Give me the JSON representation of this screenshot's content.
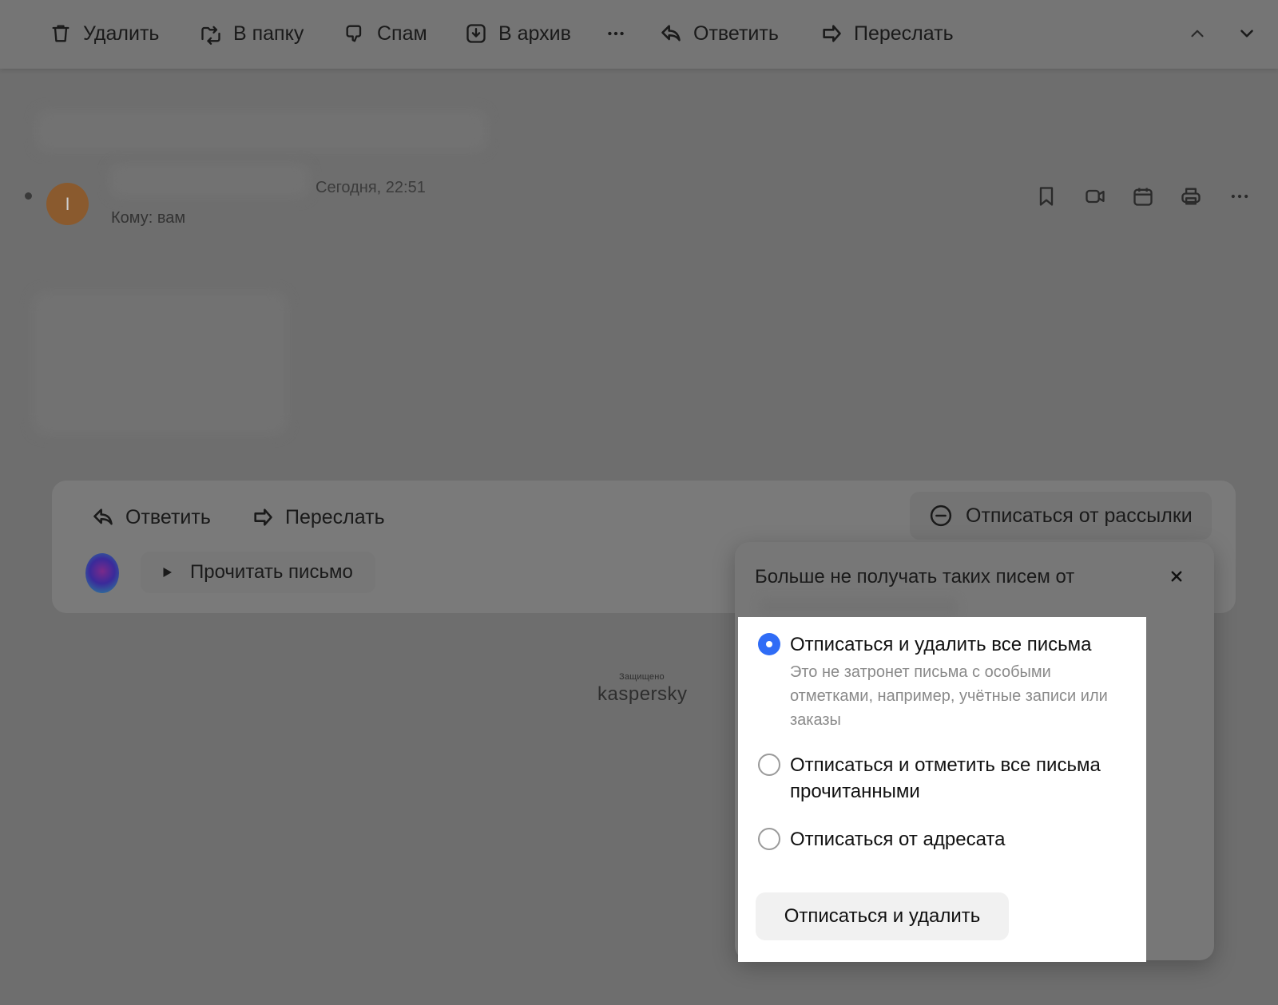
{
  "toolbar": {
    "delete": "Удалить",
    "move_to_folder": "В папку",
    "spam": "Спам",
    "archive": "В архив",
    "reply": "Ответить",
    "forward": "Переслать"
  },
  "message": {
    "date": "Сегодня, 22:51",
    "to": "Кому: вам",
    "avatar_letter": "I"
  },
  "reply_panel": {
    "reply": "Ответить",
    "forward": "Переслать",
    "unsubscribe": "Отписаться от рассылки",
    "read_aloud": "Прочитать письмо"
  },
  "kaspersky": {
    "protected": "Защищено",
    "logo": "kaspersky"
  },
  "popover": {
    "title": "Больше не получать таких писем от",
    "options": [
      {
        "label": "Отписаться и удалить все письма",
        "hint": "Это не затронет письма с особыми отметками, например, учётные записи или заказы",
        "selected": true
      },
      {
        "label": "Отписаться и отметить все письма прочитанными",
        "selected": false
      },
      {
        "label": "Отписаться от адресата",
        "selected": false
      }
    ],
    "submit": "Отписаться и удалить"
  },
  "colors": {
    "accent": "#2f6cf6",
    "avatar": "#8a5a2e",
    "overlay": "#6e6e6e"
  }
}
